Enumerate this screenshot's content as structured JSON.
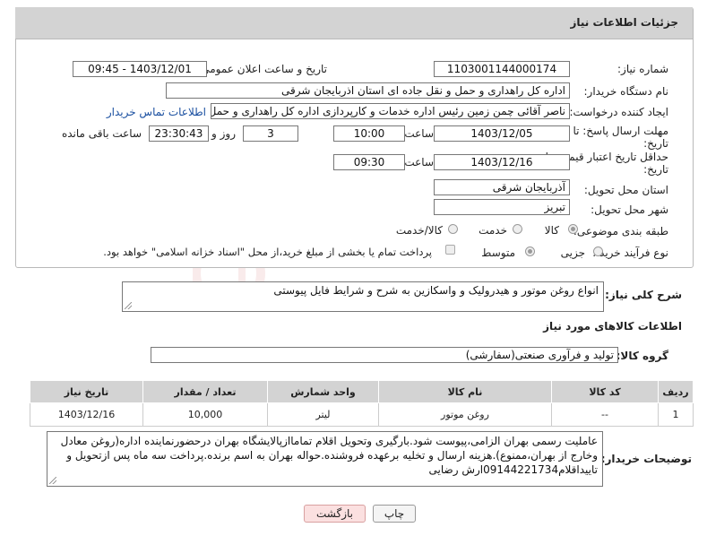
{
  "panel": {
    "title": "جزئیات اطلاعات نیاز"
  },
  "fields": {
    "need_number_label": "شماره نیاز:",
    "need_number": "1103001144000174",
    "announce_datetime_label": "تاریخ و ساعت اعلان عمومی:",
    "announce_datetime": "1403/12/01 - 09:45",
    "buyer_org_label": "نام دستگاه خریدار:",
    "buyer_org": "اداره کل راهداری و حمل و نقل جاده ای استان اذربایجان شرقی",
    "creator_label": "ایجاد کننده درخواست:",
    "creator": "ناصر آقائی چمن زمین رئیس اداره خدمات و کارپردازی اداره کل راهداری و حمل و",
    "contact_link": "اطلاعات تماس خریدار",
    "reply_deadline_label_1": "مهلت ارسال پاسخ: تا",
    "reply_deadline_label_2": "تاریخ:",
    "reply_date": "1403/12/05",
    "time_label": "ساعت",
    "reply_time": "10:00",
    "days_value": "3",
    "days_label": "روز و",
    "remaining_time": "23:30:43",
    "remaining_label": "ساعت باقی مانده",
    "price_validity_label_1": "حداقل تاریخ اعتبار قیمت: تا",
    "price_validity_label_2": "تاریخ:",
    "price_validity_date": "1403/12/16",
    "price_validity_time": "09:30",
    "delivery_province_label": "استان محل تحویل:",
    "delivery_province": "آذربایجان شرقی",
    "delivery_city_label": "شهر محل تحویل:",
    "delivery_city": "تبریز",
    "category_label": "طبقه بندی موضوعی:",
    "category_options": [
      "کالا",
      "خدمت",
      "کالا/خدمت"
    ],
    "process_label": "نوع فرآیند خرید :",
    "process_options": [
      "جزیی",
      "متوسط"
    ],
    "payment_note": "پرداخت تمام یا بخشی از مبلغ خرید،از محل \"اسناد خزانه اسلامی\" خواهد بود."
  },
  "description": {
    "label": "شرح کلی نیاز:",
    "text": "انواع روغن موتور و هیدرولیک و واسکازین به شرح و شرایط فایل پیوستی"
  },
  "goods": {
    "section_title": "اطلاعات کالاهای مورد نیاز",
    "group_label": "گروه کالا:",
    "group_value": "تولید و فرآوری صنعتی(سفارشی)"
  },
  "table": {
    "headers": [
      "ردیف",
      "کد کالا",
      "نام کالا",
      "واحد شمارش",
      "تعداد / مقدار",
      "تاریخ نیاز"
    ],
    "rows": [
      [
        "1",
        "--",
        "روغن موتور",
        "لیتر",
        "10,000",
        "1403/12/16"
      ]
    ]
  },
  "buyer_notes": {
    "label": "توضیحات خریدار:",
    "text": "عاملیت رسمی بهران الزامی،پیوست شود.بارگیری وتحویل اقلام تماماازپالایشگاه بهران درحضورنماینده اداره(روغن معادل وخارج از بهران،ممنوع).هزینه ارسال و تخلیه برعهده فروشنده.حواله بهران به اسم برنده.پرداخت سه ماه پس ازتحویل و تاییداقلام09144221734ارش رضایی"
  },
  "buttons": {
    "print": "چاپ",
    "back": "بازگشت"
  },
  "watermark": "AriaTender.neT"
}
